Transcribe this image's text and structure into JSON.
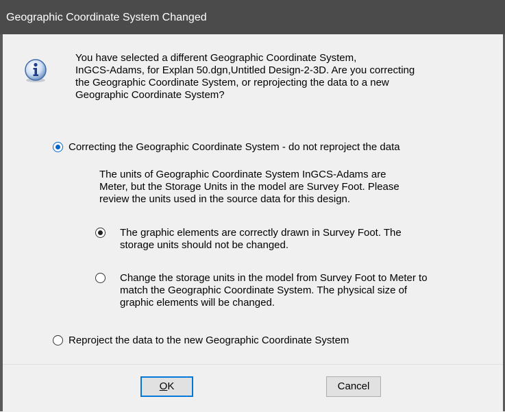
{
  "window": {
    "title": "Geographic Coordinate System Changed"
  },
  "icon": "info-icon",
  "message": {
    "lines": [
      "You have selected a different Geographic Coordinate System,",
      "InGCS-Adams, for Explan 50.dgn,Untitled Design-2-3D. Are you correcting",
      "the Geographic Coordinate System, or reprojecting the data to a new",
      "Geographic Coordinate System?"
    ]
  },
  "options": {
    "correcting": {
      "label": "Correcting the Geographic Coordinate System - do not reproject the data",
      "checked": true,
      "details": [
        "The units of Geographic Coordinate System InGCS-Adams are",
        "Meter, but the Storage Units in the model are Survey Foot. Please",
        "review the units used in the source data for this design."
      ],
      "sub_options": [
        {
          "lines": [
            "The graphic elements are correctly drawn in Survey Foot. The",
            "storage units should not be changed."
          ],
          "checked": true
        },
        {
          "lines": [
            "Change the storage units in the model from Survey Foot to Meter to",
            "match the Geographic Coordinate System. The physical size of",
            "graphic elements will be changed."
          ],
          "checked": false
        }
      ]
    },
    "reproject": {
      "label": "Reproject the data to the new Geographic Coordinate System",
      "checked": false
    }
  },
  "buttons": {
    "ok_mnemonic": "O",
    "ok_rest": "K",
    "cancel": "Cancel"
  },
  "colors": {
    "titlebar": "#4b4b4b",
    "accent": "#0078d7",
    "background": "#f0f0f0"
  }
}
